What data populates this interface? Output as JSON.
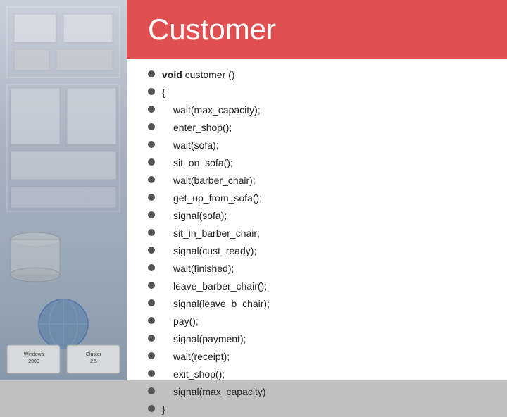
{
  "header": {
    "title": "Customer",
    "bg_color": "#e05050"
  },
  "code_lines": [
    {
      "indent": false,
      "keyword": "void",
      "text": " customer ()"
    },
    {
      "indent": false,
      "keyword": "",
      "text": "{"
    },
    {
      "indent": true,
      "keyword": "",
      "text": "wait(max_capacity);"
    },
    {
      "indent": true,
      "keyword": "",
      "text": "enter_shop();"
    },
    {
      "indent": true,
      "keyword": "",
      "text": "wait(sofa);"
    },
    {
      "indent": true,
      "keyword": "",
      "text": "sit_on_sofa();"
    },
    {
      "indent": true,
      "keyword": "",
      "text": "wait(barber_chair);"
    },
    {
      "indent": true,
      "keyword": "",
      "text": "get_up_from_sofa();"
    },
    {
      "indent": true,
      "keyword": "",
      "text": "signal(sofa);"
    },
    {
      "indent": true,
      "keyword": "",
      "text": "sit_in_barber_chair;"
    },
    {
      "indent": true,
      "keyword": "",
      "text": "signal(cust_ready);"
    },
    {
      "indent": true,
      "keyword": "",
      "text": "wait(finished);"
    },
    {
      "indent": true,
      "keyword": "",
      "text": "leave_barber_chair();"
    },
    {
      "indent": true,
      "keyword": "",
      "text": "signal(leave_b_chair);"
    },
    {
      "indent": true,
      "keyword": "",
      "text": "pay();"
    },
    {
      "indent": true,
      "keyword": "",
      "text": "signal(payment);"
    },
    {
      "indent": true,
      "keyword": "",
      "text": "wait(receipt);"
    },
    {
      "indent": true,
      "keyword": "",
      "text": "exit_shop();"
    },
    {
      "indent": true,
      "keyword": "",
      "text": "signal(max_capacity)"
    },
    {
      "indent": false,
      "keyword": "",
      "text": "}"
    }
  ],
  "left_panel": {
    "logo1": "Windows 2000",
    "logo2": "Cluster 2.5"
  }
}
